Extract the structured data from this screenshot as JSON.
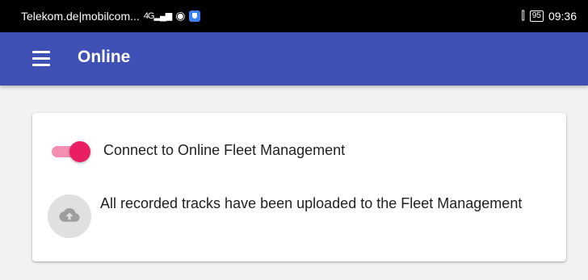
{
  "status_bar": {
    "carrier": "Telekom.de|mobilcom...",
    "network": "4G",
    "battery": "95",
    "time": "09:36",
    "icons": [
      "signal-icon",
      "wifi-hotspot-icon",
      "shield-app-icon",
      "vibrate-icon",
      "battery-icon"
    ]
  },
  "app_bar": {
    "menu_icon": "menu-icon",
    "title": "Online",
    "color": "#3f51b5"
  },
  "card": {
    "connect": {
      "label": "Connect to Online Fleet Management",
      "enabled": true,
      "accent_color": "#e91e63"
    },
    "upload_status": {
      "icon": "cloud-upload-icon",
      "text": "All recorded tracks have been uploaded to the Fleet Management"
    }
  }
}
